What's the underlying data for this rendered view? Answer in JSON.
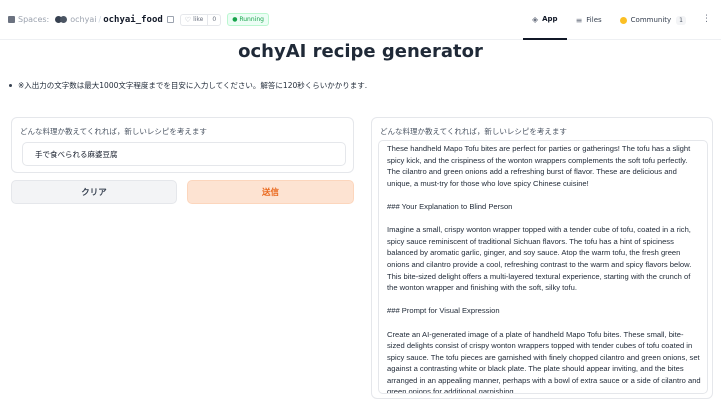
{
  "topbar": {
    "spaces_label": "Spaces:",
    "owner": "ochyai",
    "separator": "/",
    "space_name": "ochyai_food",
    "like_label": "like",
    "like_count": "0",
    "status": "Running",
    "tabs": [
      {
        "label": "App",
        "icon": "app-icon"
      },
      {
        "label": "Files",
        "icon": "files-icon"
      },
      {
        "label": "Community",
        "icon": "community-icon",
        "count": "1"
      }
    ],
    "menu_icon": "kebab-menu-icon"
  },
  "page": {
    "title": "ochyAI recipe generator",
    "note": "※入出力の文字数は最大1000文字程度までを目安に入力してください。解答に120秒くらいかかります."
  },
  "input": {
    "label": "どんな料理か教えてくれれば，新しいレシピを考えます",
    "value": "手で食べられる麻婆豆腐"
  },
  "buttons": {
    "clear": "クリア",
    "submit": "送信"
  },
  "output": {
    "label": "どんな料理か教えてくれれば，新しいレシピを考えます",
    "paragraphs": [
      "These handheld Mapo Tofu bites are perfect for parties or gatherings! The tofu has a slight spicy kick, and the crispiness of the wonton wrappers complements the soft tofu perfectly. The cilantro and green onions add a refreshing burst of flavor. These are delicious and unique, a must-try for those who love spicy Chinese cuisine!",
      "### Your Explanation to Blind Person",
      "Imagine a small, crispy wonton wrapper topped with a tender cube of tofu, coated in a rich, spicy sauce reminiscent of traditional Sichuan flavors. The tofu has a hint of spiciness balanced by aromatic garlic, ginger, and soy sauce. Atop the warm tofu, the fresh green onions and cilantro provide a cool, refreshing contrast to the warm and spicy flavors below. This bite-sized delight offers a multi-layered textural experience, starting with the crunch of the wonton wrapper and finishing with the soft, silky tofu.",
      "### Prompt for Visual Expression",
      "Create an AI-generated image of a plate of handheld Mapo Tofu bites. These small, bite-sized delights consist of crispy wonton wrappers topped with tender cubes of tofu coated in spicy sauce. The tofu pieces are garnished with finely chopped cilantro and green onions, set against a contrasting white or black plate. The plate should appear inviting, and the bites arranged in an appealing manner, perhaps with a bowl of extra sauce or a side of cilantro and green onions for additional garnishing."
    ]
  }
}
